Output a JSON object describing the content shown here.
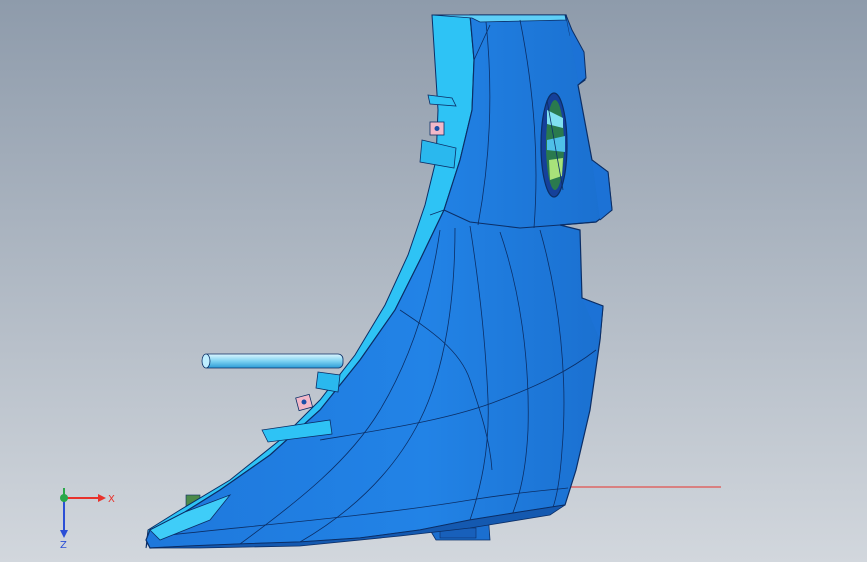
{
  "colors": {
    "bg_top": "#8e9bab",
    "bg_bottom": "#d2d7dd",
    "part_main": "#1f7fe0",
    "part_dark": "#1566c2",
    "part_light": "#2ec3f5",
    "part_edge": "#0b2e66",
    "axis_x": "#e8322b",
    "axis_y": "#2aa84a",
    "axis_z": "#2b4fd6"
  },
  "triad": {
    "x_label": "X",
    "z_label": "Z"
  }
}
